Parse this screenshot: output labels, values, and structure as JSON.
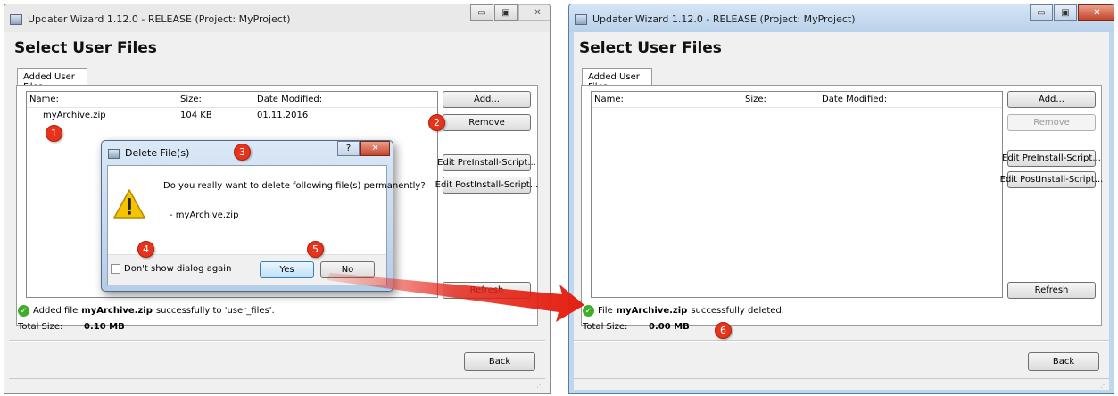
{
  "left_window": {
    "title": "Updater Wizard 1.12.0 - RELEASE (Project: MyProject)",
    "controls": [
      "▭",
      "▣",
      "✕"
    ],
    "heading": "Select User Files",
    "tab": "Added User Files",
    "columns": {
      "name": "Name:",
      "size": "Size:",
      "date": "Date Modified:"
    },
    "rows": [
      {
        "name": "myArchive.zip",
        "size": "104 KB",
        "date": "01.11.2016"
      }
    ],
    "buttons": {
      "add": "Add...",
      "remove": "Remove",
      "edit_pre": "Edit PreInstall-Script...",
      "edit_post": "Edit PostInstall-Script...",
      "refresh": "Refresh",
      "back": "Back"
    },
    "status": {
      "before": "Added file",
      "file": "myArchive.zip",
      "after": "successfully to 'user_files'."
    },
    "total_label": "Total Size:",
    "total_value": "0.10 MB"
  },
  "dialog": {
    "title": "Delete File(s)",
    "help": "?",
    "close": "✕",
    "question": "Do you really want to delete following file(s) permanently?",
    "file_line": "- myArchive.zip",
    "checkbox_label": "Don't show dialog again",
    "yes": "Yes",
    "no": "No"
  },
  "right_window": {
    "title": "Updater Wizard 1.12.0 - RELEASE (Project: MyProject)",
    "controls": [
      "▭",
      "▣",
      "✕"
    ],
    "heading": "Select User Files",
    "tab": "Added User Files",
    "columns": {
      "name": "Name:",
      "size": "Size:",
      "date": "Date Modified:"
    },
    "buttons": {
      "add": "Add...",
      "remove": "Remove",
      "edit_pre": "Edit PreInstall-Script...",
      "edit_post": "Edit PostInstall-Script...",
      "refresh": "Refresh",
      "back": "Back"
    },
    "status": {
      "before": "File",
      "file": "myArchive.zip",
      "after": "successfully deleted."
    },
    "total_label": "Total Size:",
    "total_value": "0.00 MB"
  },
  "markers": [
    "1",
    "2",
    "3",
    "4",
    "5",
    "6"
  ],
  "colors": {
    "marker": "#e5341b",
    "arrow": "#e41f12",
    "success": "#3fae2a"
  },
  "icons": [
    "app-icon",
    "warning-icon",
    "check-icon",
    "help-icon",
    "close-icon",
    "minimize-icon",
    "maximize-icon",
    "arrow-icon"
  ]
}
